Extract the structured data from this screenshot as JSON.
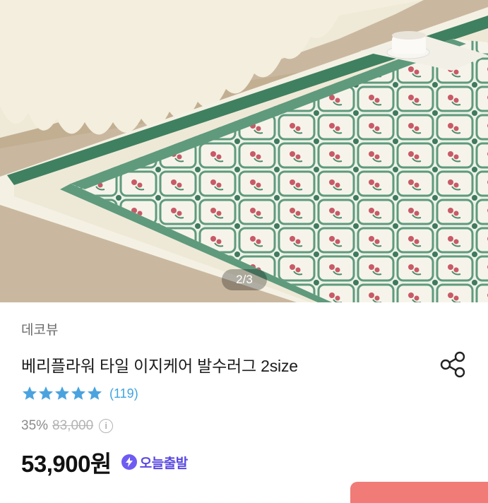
{
  "gallery": {
    "indicator": "2/3"
  },
  "product": {
    "brand": "데코뷰",
    "title": "베리플라워 타일 이지케어 발수러그 2size",
    "rating": {
      "stars": 5,
      "review_count": "(119)"
    },
    "discount": "35%",
    "original_price": "83,000",
    "price": "53,900원",
    "delivery_badge": "오늘출발"
  },
  "icons": {
    "share": "share-icon",
    "info": "info-icon",
    "star": "star-icon",
    "bolt": "bolt-icon"
  },
  "colors": {
    "star": "#4aa3df",
    "review_count": "#3fa4e0",
    "badge": "#5a49e0",
    "cta": "#f07b77"
  }
}
